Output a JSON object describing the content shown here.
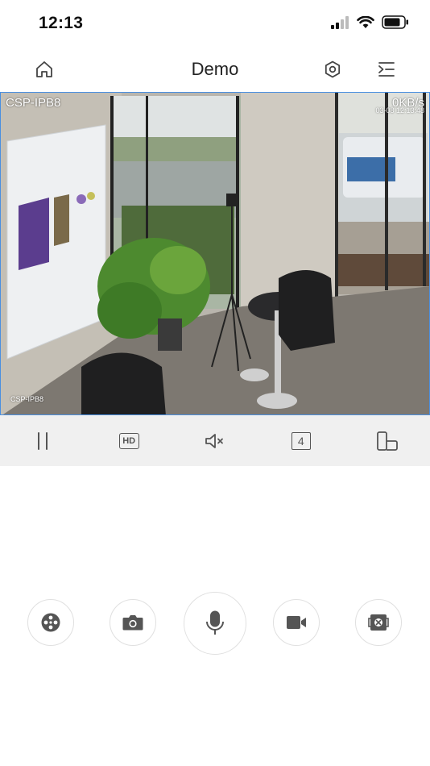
{
  "status_bar": {
    "time": "12:13"
  },
  "nav": {
    "title": "Demo"
  },
  "video": {
    "camera_name": "CSP-IPB8",
    "bitrate": "0KB/s",
    "timestamp": "03-08 12:13:48",
    "camera_overlay_label": "CSP-IPB8"
  },
  "controls": {
    "hd_label": "HD",
    "split_count": "4"
  },
  "colors": {
    "accent": "#4a8fe0",
    "icon": "#555555",
    "strip_bg": "#f0f0f0"
  },
  "icons": [
    "home-icon",
    "settings-icon",
    "menu-collapse-icon",
    "pause-icon",
    "hd-icon",
    "mute-icon",
    "split-screen-icon",
    "rotate-device-icon",
    "ptz-icon",
    "camera-icon",
    "microphone-icon",
    "video-record-icon",
    "fisheye-icon"
  ]
}
